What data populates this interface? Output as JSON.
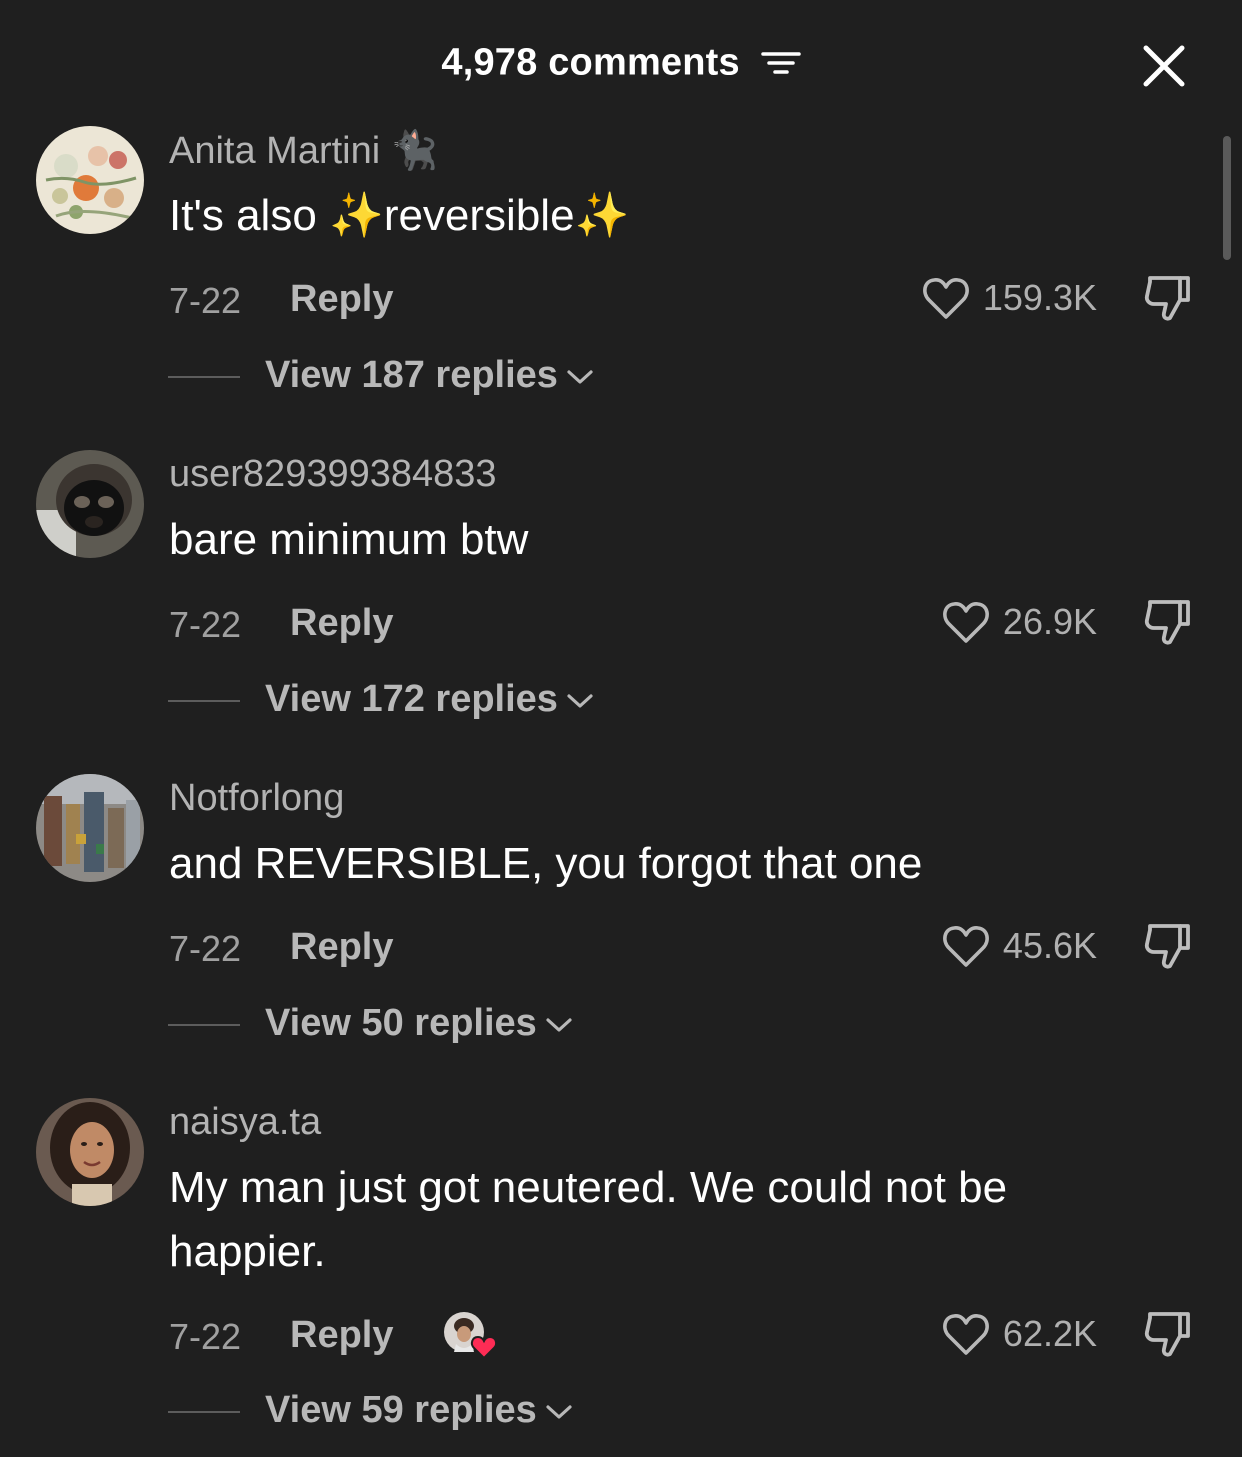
{
  "header": {
    "comment_count": "4,978 comments"
  },
  "comments": [
    {
      "username": "Anita Martini",
      "username_emoji": "🐈‍⬛",
      "text_before": "It's also ",
      "sparkle": "✨",
      "text_mid": "reversible",
      "date": "7-22",
      "reply_label": "Reply",
      "likes": "159.3K",
      "view_replies": "View 187 replies"
    },
    {
      "username": "user829399384833",
      "text": "bare minimum btw",
      "date": "7-22",
      "reply_label": "Reply",
      "likes": "26.9K",
      "view_replies": "View 172 replies"
    },
    {
      "username": "Notforlong",
      "text": "and REVERSIBLE, you forgot that one",
      "date": "7-22",
      "reply_label": "Reply",
      "likes": "45.6K",
      "view_replies": "View 50 replies"
    },
    {
      "username": "naisya.ta",
      "text": "My man just got neutered. We could not be happier.",
      "date": "7-22",
      "reply_label": "Reply",
      "likes": "62.2K",
      "view_replies": "View 59 replies"
    }
  ],
  "colors": {
    "background": "#1f1f1f",
    "username": "#b3b3b3",
    "meta": "#a0a0a0",
    "heart_badge": "#fe2c55"
  }
}
